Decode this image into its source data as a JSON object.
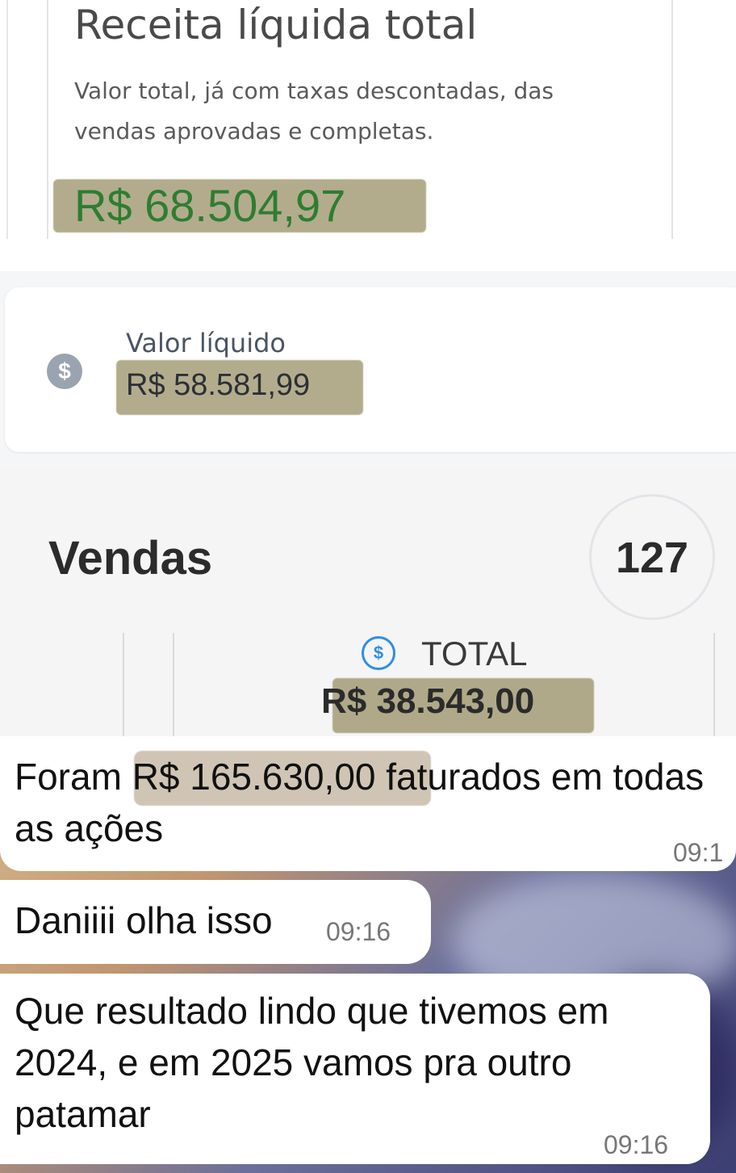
{
  "receita": {
    "title": "Receita líquida total",
    "description": "Valor total, já com taxas descontadas, das vendas aprovadas e completas.",
    "amount": "R$ 68.504,97"
  },
  "valor_liquido": {
    "label": "Valor líquido",
    "amount": "R$ 58.581,99",
    "icon": "dollar-circle-icon"
  },
  "vendas": {
    "title": "Vendas",
    "count": "127",
    "total_label": "TOTAL",
    "total_amount": "R$ 38.543,00",
    "icon": "dollar-outline-icon"
  },
  "chat": {
    "messages": [
      {
        "text_before": "Foram ",
        "highlight": "R$ 165.630,00",
        "text_after": " faturados em todas as ações",
        "time": "09:1"
      },
      {
        "text": "Daniiii olha isso",
        "time": "09:16"
      },
      {
        "text": "Que resultado lindo que tivemos em 2024, e em 2025 vamos pra outro patamar",
        "time": "09:16"
      }
    ]
  },
  "colors": {
    "highlight": "#968c5f",
    "amount_green": "#2e7d32",
    "icon_blue": "#2f8ee8"
  }
}
